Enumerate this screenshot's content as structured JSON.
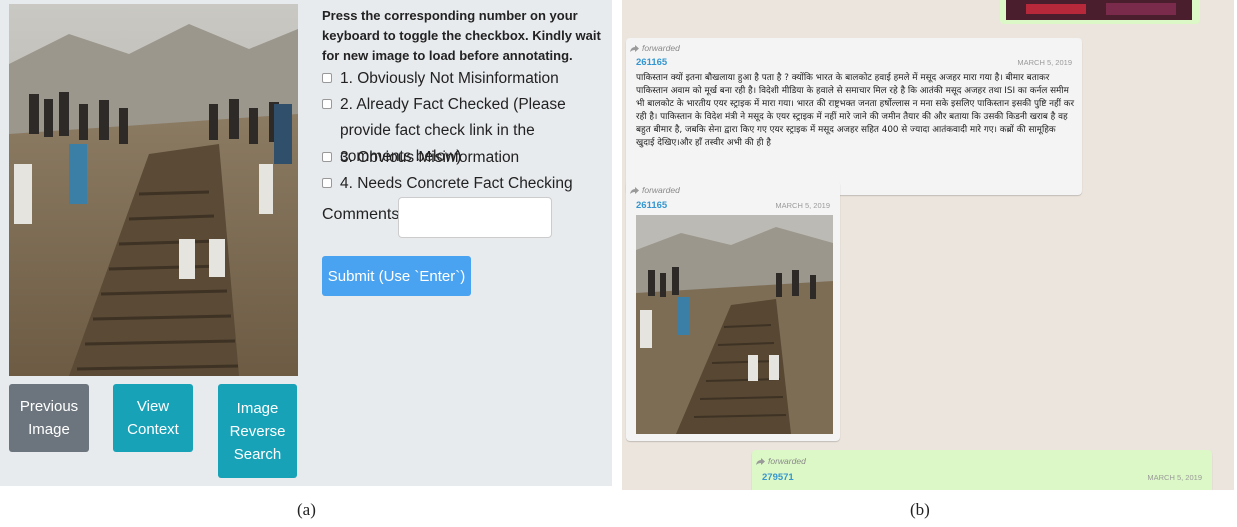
{
  "panel_a": {
    "instructions": "Press the corresponding number on your keyboard to toggle the checkbox. Kindly wait for new image to load before annotating.",
    "options": [
      "1. Obviously Not Misinformation",
      "2. Already Fact Checked (Please provide fact check link in the comments below)",
      "3. Obvious Misinformation",
      "4. Needs Concrete Fact Checking"
    ],
    "comments_label": "Comments:",
    "comments_value": "",
    "submit_label": "Submit (Use `Enter`)",
    "buttons": {
      "previous": "Previous Image",
      "view_context": "View Context",
      "reverse_search": "Image Reverse Search"
    },
    "colors": {
      "teal": "#17a2b8",
      "gray": "#6c757d",
      "submit_blue": "#4aa3f0",
      "background": "#e8ebee"
    }
  },
  "panel_b": {
    "messages": [
      {
        "forwarded": "forwarded",
        "sender": "261165",
        "date": "MARCH 5, 2019",
        "text": "पाकिस्तान क्यों इतना बौखलाया हुआ है पता है ? क्योंकि भारत के बालकोट हवाई हमले में मसूद अजहर मारा गया है। बीमार बताकर पाकिस्तान अवाम को मूर्ख बना रही है। विदेशी मीडिया के हवाले से समाचार मिल रहे है कि आतंकी मसूद अजहर तथा ISI का कर्नल समीम भी बालकोट के भारतीय एयर स्ट्राइक में मारा गया। भारत की राष्ट्रभक्त जनता हर्षोल्लास न मना सके इसलिए पाकिस्तान इसकी पुष्टि नहीं कर रही है। पाकिस्तान के विदेश मंत्री ने मसूद के एयर स्ट्राइक में नहीं मारे जाने की जमीन तैयार की और बताया कि उसकी किडनी खराब है वह बहुत बीमार है, जबकि सेना द्वारा किए गए एयर स्ट्राइक में मसूद अजहर सहित 400 से ज्यादा आतंकवादी मारे गए। कब्रों की सामूहिक खुदाई देखिए।और हाँ तस्वीर अभी की ही है"
      },
      {
        "forwarded": "forwarded",
        "sender": "261165",
        "date": "MARCH 5, 2019"
      },
      {
        "forwarded": "forwarded",
        "sender": "279571",
        "date": "MARCH 5, 2019"
      }
    ],
    "colors": {
      "chat_bg": "#ece5dd",
      "bubble": "#f4f4f4",
      "bubble_green": "#dcf8c6",
      "sender": "#3596d0"
    }
  },
  "captions": {
    "a": "(a)",
    "b": "(b)"
  }
}
